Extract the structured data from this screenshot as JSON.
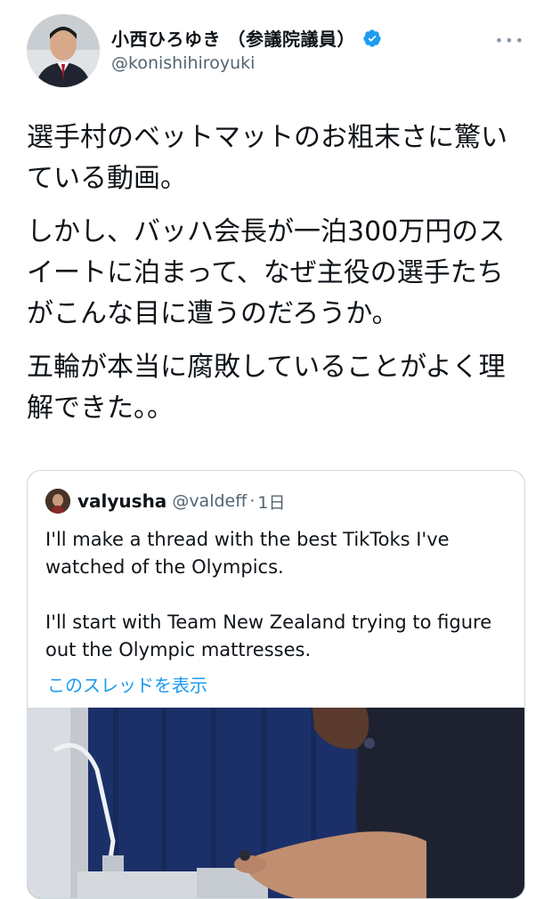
{
  "author": {
    "display_name": "小西ひろゆき （参議院議員）",
    "handle": "@konishihiroyuki",
    "verified_icon": "verified-badge-icon",
    "more_label": "•••"
  },
  "tweet": {
    "paragraphs": [
      "選手村のベットマットのお粗末さに驚いている動画。",
      "しかし、バッハ会長が一泊300万円のスイートに泊まって、なぜ主役の選手たちがこんな目に遭うのだろうか。",
      "五輪が本当に腐敗していることがよく理解できた。。"
    ]
  },
  "quote": {
    "name": "valyusha",
    "handle": "@valdeff",
    "separator": "·",
    "time": "1日",
    "paragraphs": [
      "I'll make a thread with the best TikToks I've watched of the Olympics.",
      "I'll start with Team New Zealand trying to figure out the Olympic mattresses."
    ],
    "show_thread_label": "このスレッドを表示"
  },
  "colors": {
    "link": "#1d9bf0",
    "verified": "#1d9bf0",
    "secondary_text": "#536471"
  }
}
